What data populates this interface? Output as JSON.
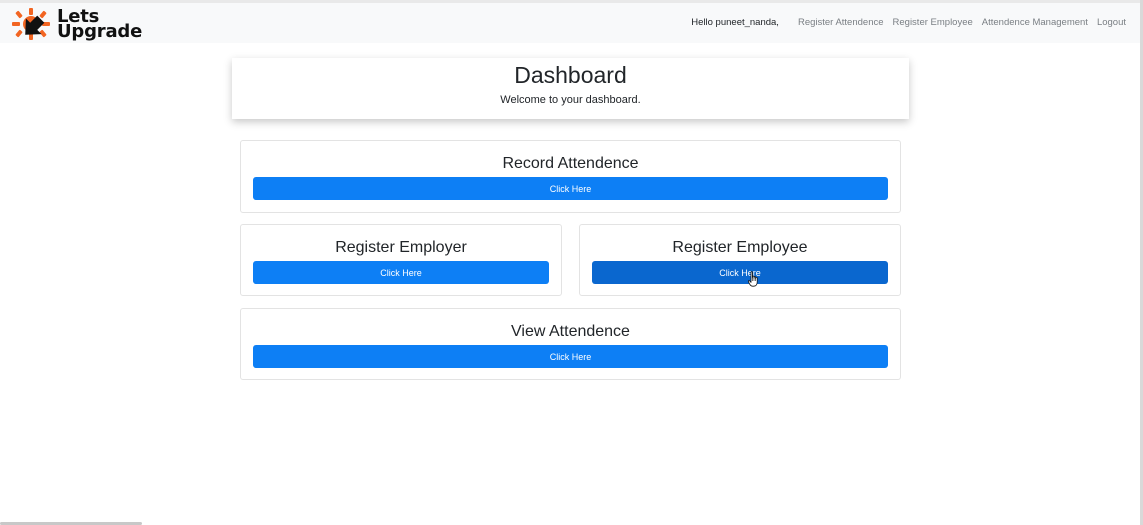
{
  "brand": {
    "line1": "Lets",
    "line2": "Upgrade",
    "logo_colors": {
      "orange": "#f26522",
      "dark": "#111111"
    }
  },
  "nav": {
    "greeting": "Hello puneet_nanda,",
    "links": [
      "Register Attendence",
      "Register Employee",
      "Attendence Management",
      "Logout"
    ]
  },
  "header": {
    "title": "Dashboard",
    "subtitle": "Welcome to your dashboard."
  },
  "cards": {
    "record": {
      "title": "Record Attendence",
      "button": "Click Here"
    },
    "employer": {
      "title": "Register Employer",
      "button": "Click Here"
    },
    "employee": {
      "title": "Register Employee",
      "button": "Click Here"
    },
    "view": {
      "title": "View Attendence",
      "button": "Click Here"
    }
  },
  "colors": {
    "primary_button": "#0d7ff5",
    "hover_button": "#0a67cf",
    "navbar_bg": "#f8f9fa"
  },
  "icons": {
    "brand_logo": "lets-upgrade-logo-icon",
    "pointer": "hand-pointer-cursor-icon"
  }
}
